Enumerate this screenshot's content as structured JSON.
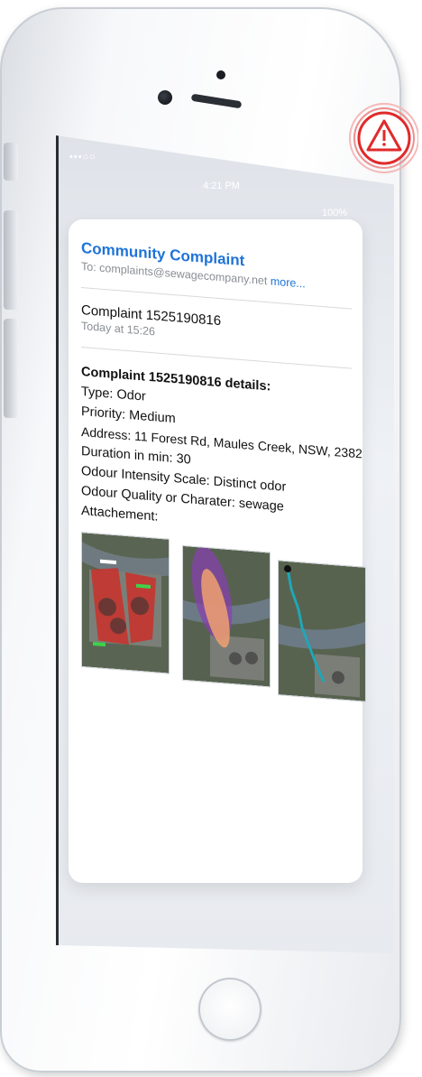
{
  "status_bar": {
    "carrier": "•••○○",
    "time": "4:21 PM",
    "battery": "100%"
  },
  "email": {
    "subject": "Community Complaint",
    "to_label": "To:",
    "to_address": "complaints@sewagecompany.net",
    "more_link": "more...",
    "message_title": "Complaint 1525190816",
    "message_date": "Today at 15:26",
    "details_heading": "Complaint 1525190816 details:",
    "type": "Type: Odor",
    "priority": "Priority: Medium",
    "address": "Address: 11 Forest Rd, Maules Creek, NSW, 2382",
    "duration": "Duration in min: 30",
    "intensity": "Odour Intensity Scale: Distinct odor",
    "quality": "Odour Quality or Charater: sewage",
    "attachment_label": "Attachement:"
  },
  "attachments": [
    {
      "name": "odour-source-map"
    },
    {
      "name": "odour-plume-map"
    },
    {
      "name": "odour-route-map"
    }
  ],
  "colors": {
    "link": "#1e73d8",
    "alert": "#e02a2a",
    "secondary_text": "#8a8e94"
  }
}
